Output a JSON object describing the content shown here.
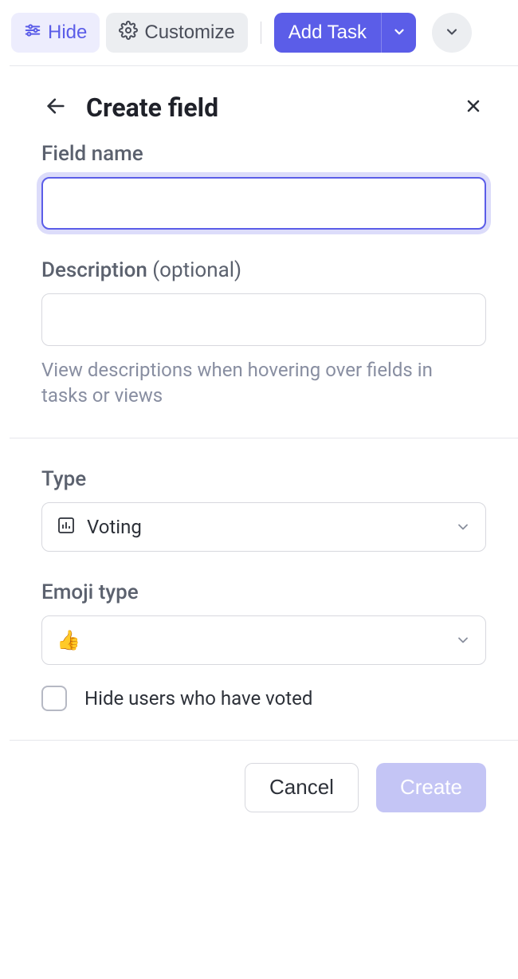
{
  "toolbar": {
    "hide_label": "Hide",
    "customize_label": "Customize",
    "add_task_label": "Add Task"
  },
  "panel": {
    "title": "Create field"
  },
  "form": {
    "field_name_label": "Field name",
    "field_name_value": "",
    "description_label": "Description",
    "description_optional": " (optional)",
    "description_value": "",
    "description_hint": "View descriptions when hovering over fields in tasks or views",
    "type_label": "Type",
    "type_value": "Voting",
    "emoji_type_label": "Emoji type",
    "emoji_value": "👍",
    "hide_users_label": "Hide users who have voted",
    "hide_users_checked": false
  },
  "footer": {
    "cancel_label": "Cancel",
    "create_label": "Create"
  }
}
